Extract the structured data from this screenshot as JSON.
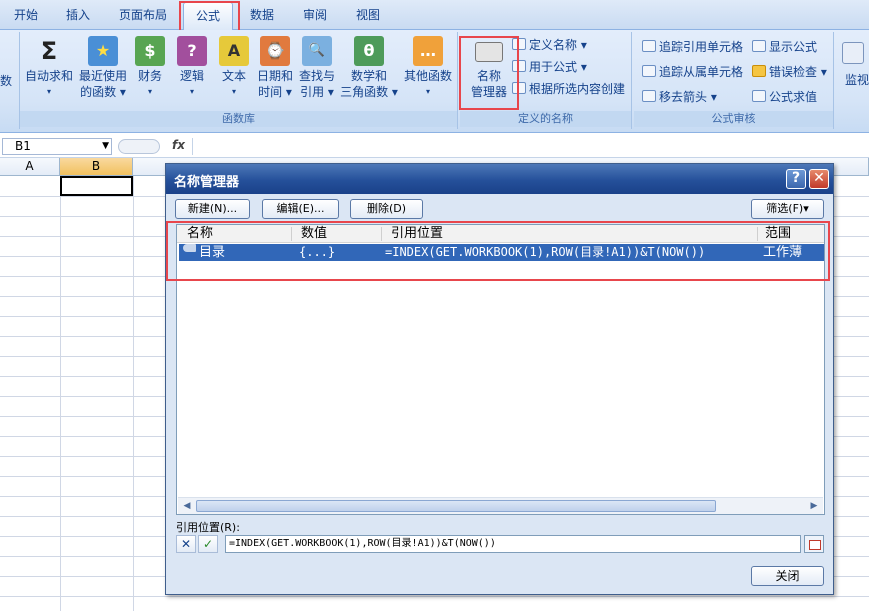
{
  "ribbon": {
    "tabs": [
      "开始",
      "插入",
      "页面布局",
      "公式",
      "数据",
      "审阅",
      "视图"
    ],
    "active_tab": "公式",
    "left_cut_label": "数",
    "library_buttons": [
      {
        "line1": "自动求和",
        "line2": "▾",
        "icon": "Σ"
      },
      {
        "line1": "最近使用",
        "line2": "的函数 ▾",
        "icon": "★"
      },
      {
        "line1": "财务",
        "line2": "▾",
        "icon": "$"
      },
      {
        "line1": "逻辑",
        "line2": "▾",
        "icon": "?"
      },
      {
        "line1": "文本",
        "line2": "▾",
        "icon": "A"
      },
      {
        "line1": "日期和",
        "line2": "时间 ▾",
        "icon": "⌚"
      },
      {
        "line1": "查找与",
        "line2": "引用 ▾",
        "icon": "🔍"
      },
      {
        "line1": "数学和",
        "line2": "三角函数 ▾",
        "icon": "θ"
      },
      {
        "line1": "其他函数",
        "line2": "▾",
        "icon": "…"
      }
    ],
    "library_group_label": "函数库",
    "name_manager": {
      "line1": "名称",
      "line2": "管理器"
    },
    "defined_names_items": [
      "定义名称 ▾",
      "用于公式 ▾",
      "根据所选内容创建"
    ],
    "defined_names_group_label": "定义的名称",
    "audit_items": [
      "追踪引用单元格",
      "追踪从属单元格",
      "移去箭头 ▾",
      "显示公式",
      "错误检查 ▾",
      "公式求值"
    ],
    "audit_group_label": "公式审核",
    "watch_label": "监视"
  },
  "formula_bar": {
    "cell_ref": "B1",
    "fx": "fx"
  },
  "grid": {
    "columns": [
      "A",
      "B"
    ]
  },
  "dialog": {
    "title": "名称管理器",
    "help": "?",
    "close": "✕",
    "new_btn": "新建(N)...",
    "edit_btn": "编辑(E)...",
    "delete_btn": "删除(D)",
    "filter_btn": "筛选(F)▾",
    "columns": {
      "name": "名称",
      "value": "数值",
      "refers_to": "引用位置",
      "scope": "范围"
    },
    "rows": [
      {
        "name": "目录",
        "value": "{...}",
        "refers_to": "=INDEX(GET.WORKBOOK(1),ROW(目录!A1))&T(NOW())",
        "scope": "工作薄"
      }
    ],
    "refers_label": "引用位置(R):",
    "refers_value": "=INDEX(GET.WORKBOOK(1),ROW(目录!A1))&T(NOW())",
    "cancel_icon": "✕",
    "confirm_icon": "✓",
    "close_btn": "关闭"
  }
}
